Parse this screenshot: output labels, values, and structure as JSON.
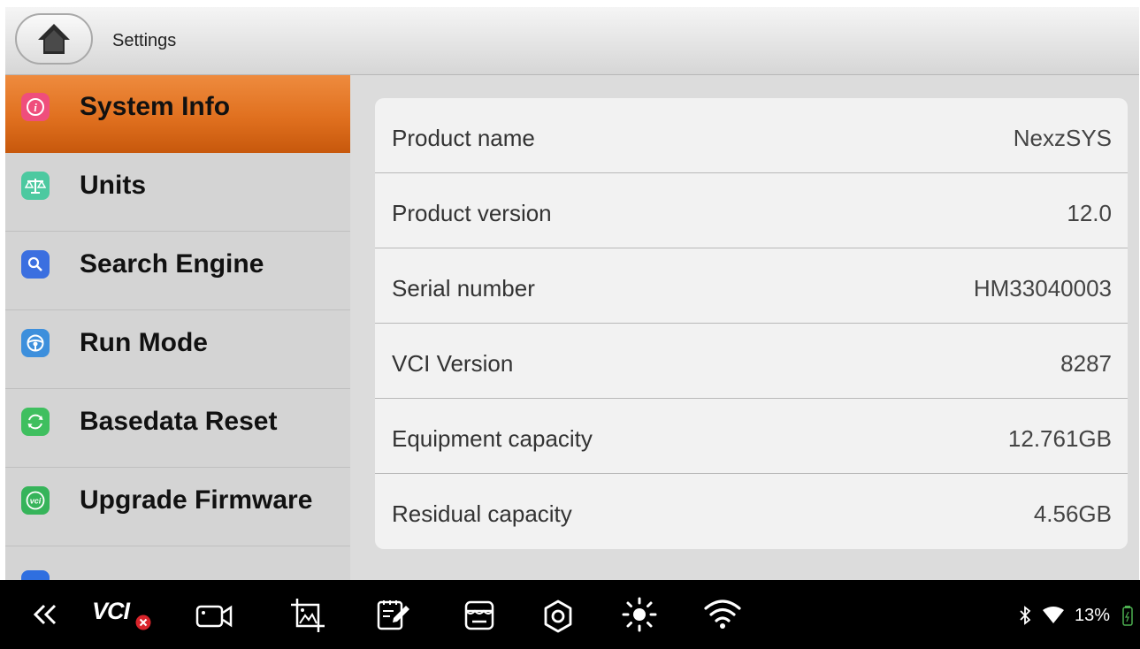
{
  "header": {
    "title": "Settings"
  },
  "sidebar": {
    "items": [
      {
        "label": "System Info",
        "icon": "info-icon",
        "color": "#ef4e7c",
        "active": true
      },
      {
        "label": "Units",
        "icon": "scale-icon",
        "color": "#4cc9a0",
        "active": false
      },
      {
        "label": "Search Engine",
        "icon": "search-icon",
        "color": "#3b6fe0",
        "active": false
      },
      {
        "label": "Run Mode",
        "icon": "steering-wheel-icon",
        "color": "#3d8fdc",
        "active": false
      },
      {
        "label": "Basedata Reset",
        "icon": "refresh-icon",
        "color": "#3fbf5f",
        "active": false
      },
      {
        "label": "Upgrade Firmware",
        "icon": "vci-upgrade-icon",
        "color": "#36b45a",
        "active": false
      }
    ]
  },
  "info": {
    "rows": [
      {
        "label": "Product name",
        "value": "NexzSYS"
      },
      {
        "label": "Product version",
        "value": "12.0"
      },
      {
        "label": "Serial number",
        "value": "HM33040003"
      },
      {
        "label": "VCI Version",
        "value": "8287"
      },
      {
        "label": "Equipment capacity",
        "value": "12.761GB"
      },
      {
        "label": "Residual capacity",
        "value": "4.56GB"
      }
    ]
  },
  "taskbar": {
    "vci_label": "VCI",
    "battery": "13%",
    "icons": [
      "back-double-chevron-icon",
      "vci-disconnected-icon",
      "screen-record-icon",
      "screenshot-crop-icon",
      "notes-edit-icon",
      "store-icon",
      "settings-gear-icon",
      "brightness-icon",
      "wifi-icon"
    ]
  },
  "colors": {
    "accent": "#e0701f",
    "taskbar": "#000000"
  }
}
